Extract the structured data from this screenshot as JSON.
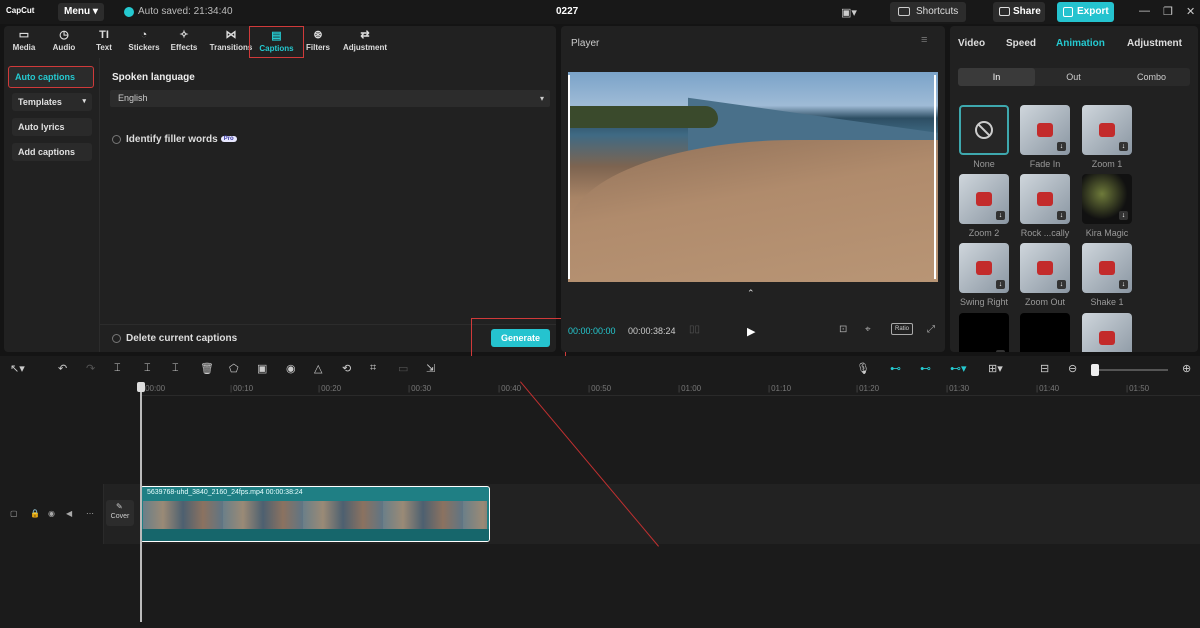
{
  "topbar": {
    "logo": "CapCut",
    "menu_label": "Menu",
    "autosave": "Auto saved: 21:34:40",
    "project_title": "0227",
    "shortcuts_label": "Shortcuts",
    "share_label": "Share",
    "export_label": "Export"
  },
  "tools": [
    {
      "label": "Media",
      "icon": "media-icon"
    },
    {
      "label": "Audio",
      "icon": "audio-icon"
    },
    {
      "label": "Text",
      "icon": "text-icon"
    },
    {
      "label": "Stickers",
      "icon": "stickers-icon"
    },
    {
      "label": "Effects",
      "icon": "effects-icon"
    },
    {
      "label": "Transitions",
      "icon": "transitions-icon"
    },
    {
      "label": "Captions",
      "icon": "captions-icon",
      "active": true
    },
    {
      "label": "Filters",
      "icon": "filters-icon"
    },
    {
      "label": "Adjustment",
      "icon": "adjustment-icon"
    }
  ],
  "subnav": [
    {
      "label": "Auto captions",
      "active": true
    },
    {
      "label": "Templates"
    },
    {
      "label": "Auto lyrics"
    },
    {
      "label": "Add captions"
    }
  ],
  "captions": {
    "spoken_language_label": "Spoken language",
    "language_value": "English",
    "filler_label": "Identify filler words",
    "pro_badge": "Pro",
    "delete_label": "Delete current captions",
    "generate_label": "Generate"
  },
  "player": {
    "title": "Player",
    "current_time": "00:00:00:00",
    "total_time": "00:00:38:24",
    "ratio_label": "Ratio"
  },
  "right_tabs": [
    {
      "label": "Video"
    },
    {
      "label": "Speed"
    },
    {
      "label": "Animation",
      "active": true
    },
    {
      "label": "Adjustment"
    }
  ],
  "segments": [
    {
      "label": "In",
      "active": true
    },
    {
      "label": "Out"
    },
    {
      "label": "Combo"
    }
  ],
  "animations": [
    {
      "label": "None",
      "style": "none"
    },
    {
      "label": "Fade In",
      "style": "car"
    },
    {
      "label": "Zoom 1",
      "style": "car"
    },
    {
      "label": "Zoom 2",
      "style": "car"
    },
    {
      "label": "Rock ...cally",
      "style": "car"
    },
    {
      "label": "Kira Magic",
      "style": "dark"
    },
    {
      "label": "Swing Right",
      "style": "car"
    },
    {
      "label": "Zoom Out",
      "style": "car"
    },
    {
      "label": "Shake 1",
      "style": "car"
    },
    {
      "label": "",
      "style": "black"
    },
    {
      "label": "",
      "style": "black"
    },
    {
      "label": "",
      "style": "car"
    }
  ],
  "ruler_ticks": [
    "00:00",
    "00:10",
    "00:20",
    "00:30",
    "00:40",
    "00:50",
    "01:00",
    "01:10",
    "01:20",
    "01:30",
    "01:40",
    "01:50"
  ],
  "timeline": {
    "cover_label": "Cover",
    "clip_label": "5639768-uhd_3840_2160_24fps.mp4   00:00:38:24"
  },
  "colors": {
    "accent": "#25c3cf",
    "highlight": "#d03a3a"
  }
}
